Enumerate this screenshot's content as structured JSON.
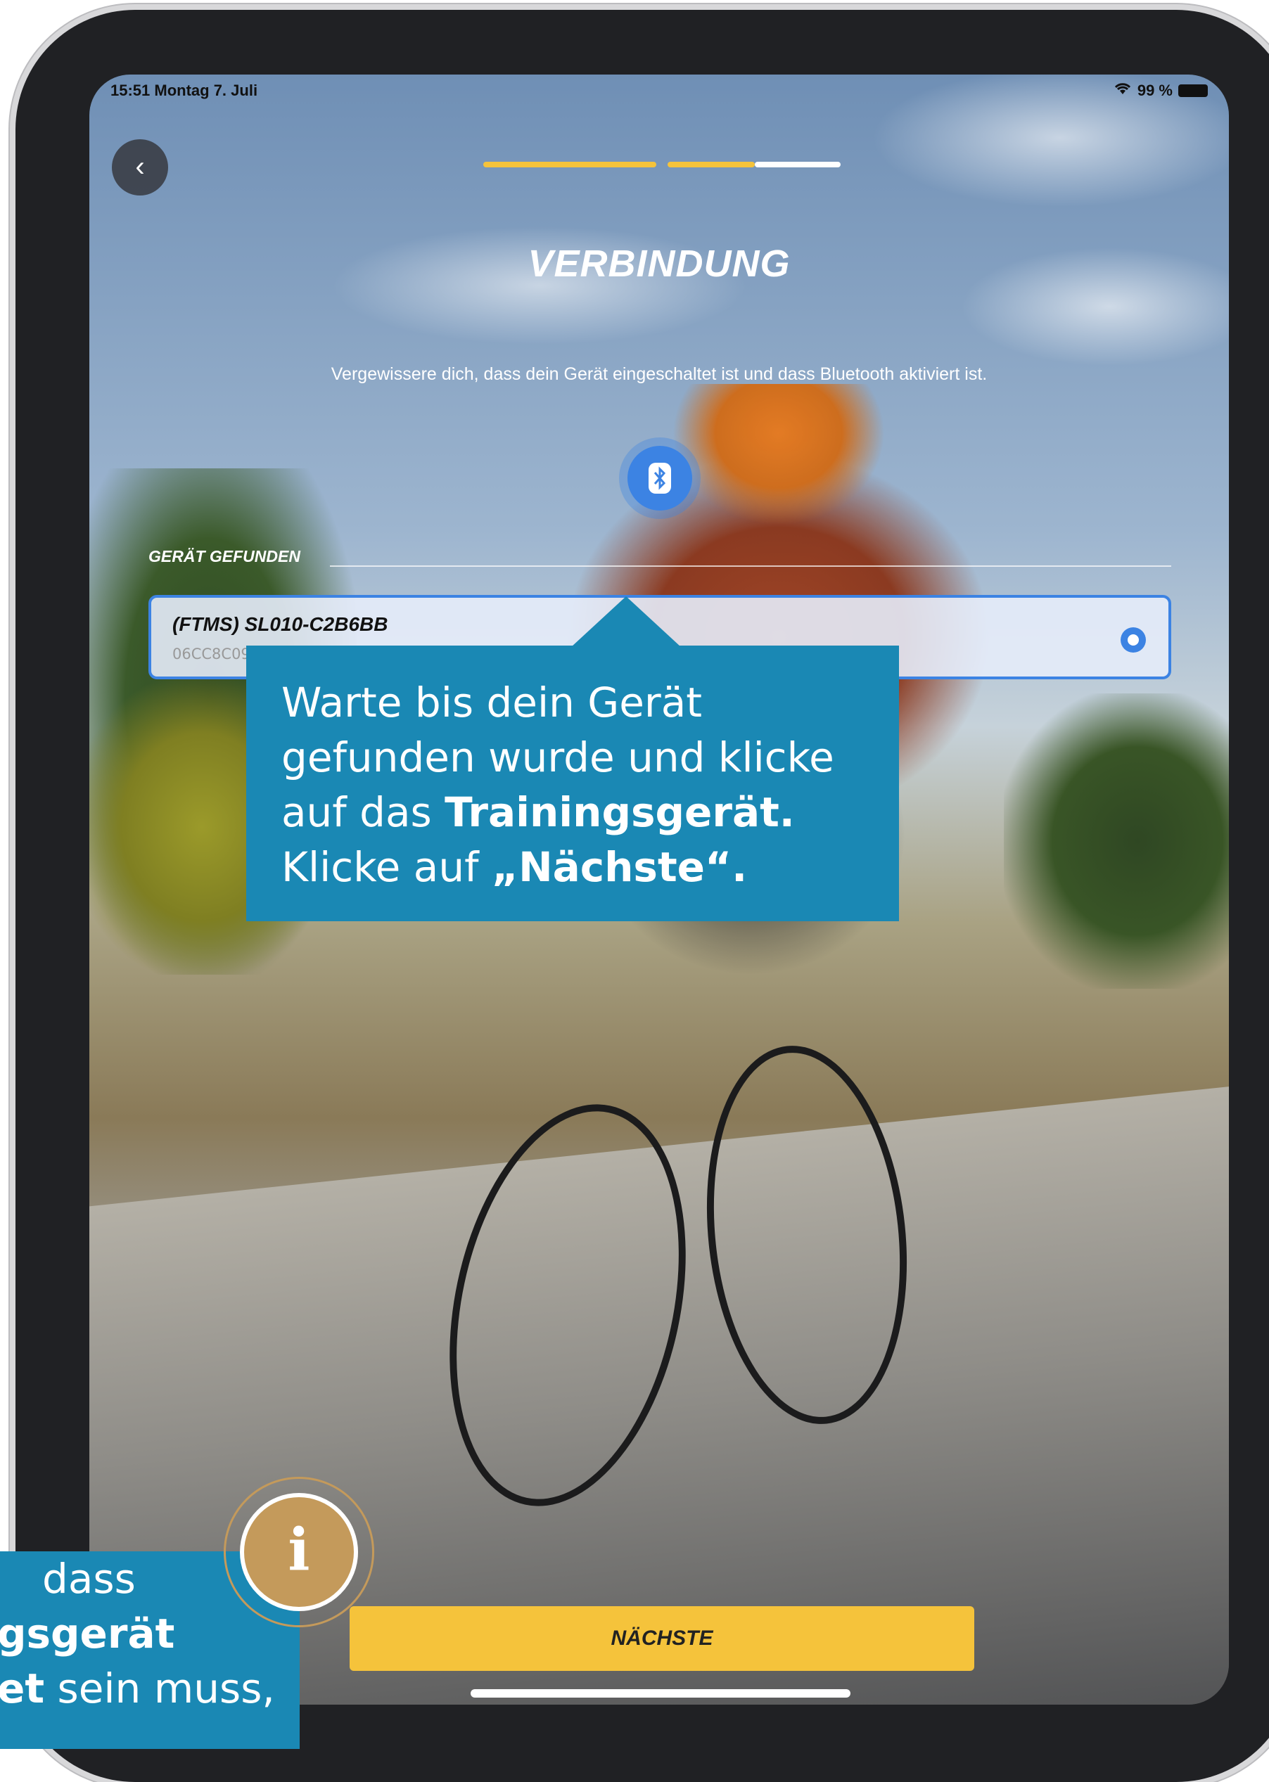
{
  "status_bar": {
    "time": "15:51  Montag 7. Juli",
    "battery": "99 %",
    "wifi_icon": "wifi-icon"
  },
  "header": {
    "back_icon": "‹",
    "title": "VERBINDUNG",
    "subtitle": "Vergewissere dich, dass dein Gerät eingeschaltet ist und dass Bluetooth aktiviert ist.",
    "progress_colors": {
      "done": "#f5c33b",
      "todo": "#ffffff"
    }
  },
  "bluetooth_icon": "ʙ",
  "found_section": {
    "label": "GERÄT GEFUNDEN"
  },
  "device": {
    "name": "(FTMS) SL010-C2B6BB",
    "id": "06CC8C09-C94F-53C3-903B-9CE7532A6C0E",
    "selected": true
  },
  "tooltip": {
    "line1": "Warte bis dein Gerät",
    "line2": "gefunden wurde und klicke",
    "line3_prefix": "auf das ",
    "line3_bold": "Trainingsgerät.",
    "line4_prefix": "Klicke auf ",
    "line4_bold": "„Nächste“."
  },
  "next_button": {
    "label": "NÄCHSTE"
  },
  "info_badge": {
    "glyph": "i"
  },
  "side_callout": {
    "line1": "dass",
    "line2": "gsgerät",
    "line3_bold": "et",
    "line3_rest": " sein muss,"
  },
  "colors": {
    "accent_blue": "#3c83e3",
    "callout_blue": "#1a88b4",
    "button_yellow": "#f5c33b",
    "info_gold": "#c49a5b"
  }
}
